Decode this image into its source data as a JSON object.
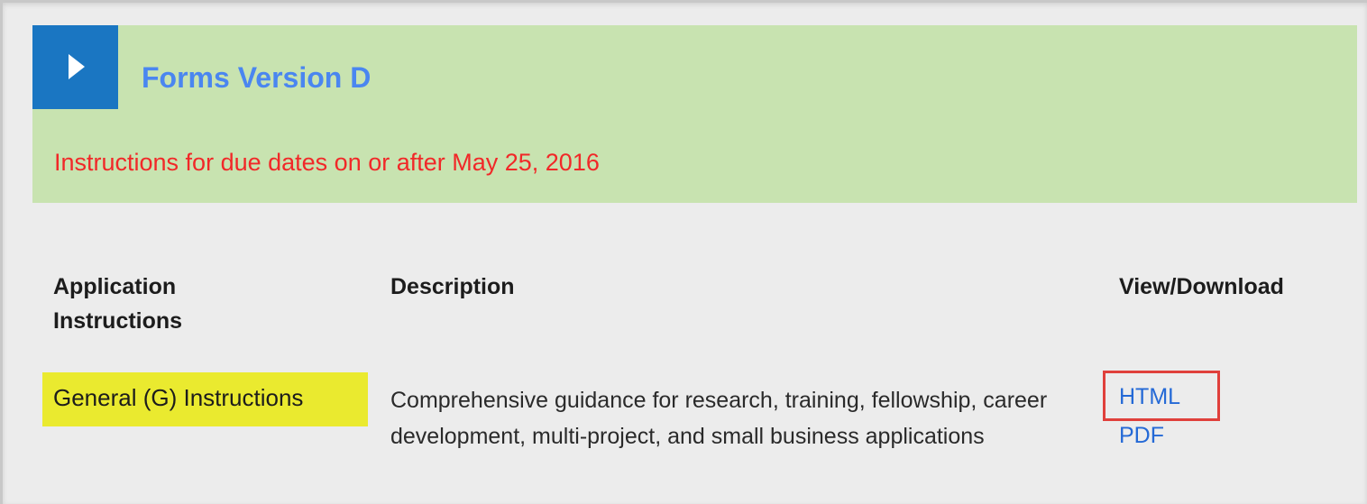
{
  "panel": {
    "title": "Forms Version D",
    "subtitle": "Instructions for due dates on or after May 25, 2016",
    "toggle_icon": "chevron-right-icon",
    "colors": {
      "header_bg": "#c8e3b0",
      "toggle_bg": "#1a76c2",
      "title": "#4a86f0",
      "subtitle": "#f12828"
    }
  },
  "table": {
    "headers": {
      "application": "Application Instructions",
      "description": "Description",
      "view": "View/Download"
    },
    "rows": [
      {
        "application": "General (G) Instructions",
        "description": "Comprehensive guidance for research, training, fellowship, career development, multi-project, and small business applications",
        "links": [
          "HTML",
          "PDF"
        ]
      }
    ],
    "colors": {
      "highlight": "#eaea2f",
      "link": "#2469d6",
      "callout": "#e0403c"
    }
  }
}
